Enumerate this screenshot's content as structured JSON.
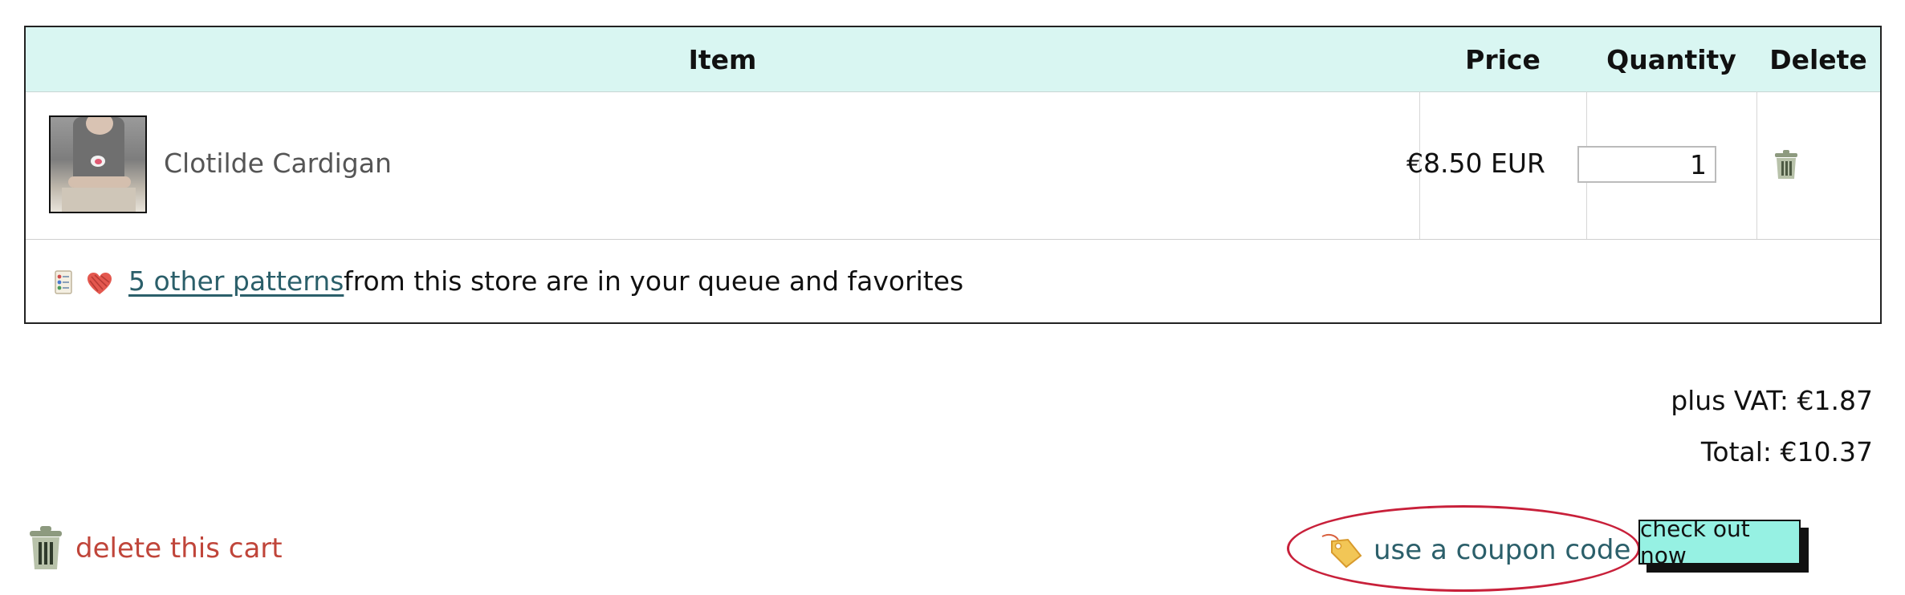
{
  "table": {
    "headers": {
      "item": "Item",
      "price": "Price",
      "quantity": "Quantity",
      "delete": "Delete"
    },
    "rows": [
      {
        "name": "Clotilde Cardigan",
        "price": "€8.50 EUR",
        "quantity": "1"
      }
    ],
    "note": {
      "link": "5 other patterns",
      "text": "from this store are in your queue and favorites"
    }
  },
  "totals": {
    "vat": "plus VAT: €1.87",
    "total": "Total: €10.37"
  },
  "actions": {
    "delete_cart": "delete this cart",
    "coupon": "use a coupon code",
    "checkout": "check out now"
  },
  "icons": {
    "delete_row": "trash-icon",
    "queue": "queue-list-icon",
    "favorites": "heart-yarn-icon",
    "delete_cart": "trash-icon",
    "coupon": "price-tag-icon"
  },
  "colors": {
    "header_bg": "#d9f6f2",
    "link": "#2b5f6a",
    "danger": "#c0453a",
    "highlight_circle": "#c8203a",
    "checkout_bg": "#96f1e3"
  }
}
